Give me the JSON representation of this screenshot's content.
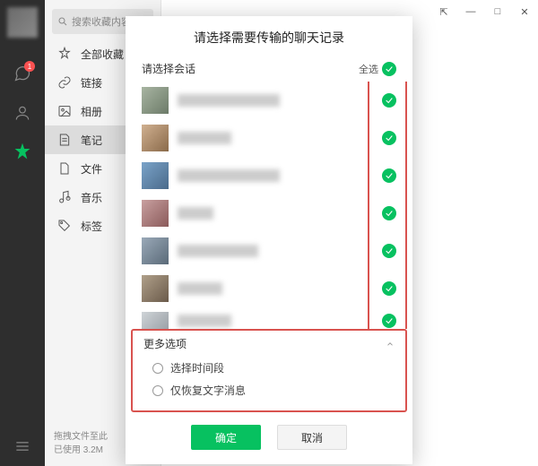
{
  "rail": {
    "badge_count": "1"
  },
  "fav_sidebar": {
    "search_placeholder": "搜索收藏内容",
    "items": [
      {
        "label": "全部收藏",
        "icon": "star"
      },
      {
        "label": "链接",
        "icon": "link"
      },
      {
        "label": "相册",
        "icon": "image"
      },
      {
        "label": "笔记",
        "icon": "note",
        "selected": true
      },
      {
        "label": "文件",
        "icon": "file"
      },
      {
        "label": "音乐",
        "icon": "music"
      },
      {
        "label": "标签",
        "icon": "tag"
      }
    ],
    "footer_line1": "拖拽文件至此",
    "footer_line2": "已使用 3.2M"
  },
  "window_controls": {
    "pin": "⇱",
    "min": "—",
    "max": "□",
    "close": "✕"
  },
  "dialog": {
    "title": "请选择需要传输的聊天记录",
    "select_label": "请选择会话",
    "select_all_label": "全选",
    "conversations": [
      {
        "selected": true
      },
      {
        "selected": true
      },
      {
        "selected": true
      },
      {
        "selected": true
      },
      {
        "selected": true
      },
      {
        "selected": true
      },
      {
        "selected": true
      }
    ],
    "more_options_label": "更多选项",
    "option_time_range": "选择时间段",
    "option_text_only": "仅恢复文字消息",
    "confirm_label": "确定",
    "cancel_label": "取消"
  }
}
